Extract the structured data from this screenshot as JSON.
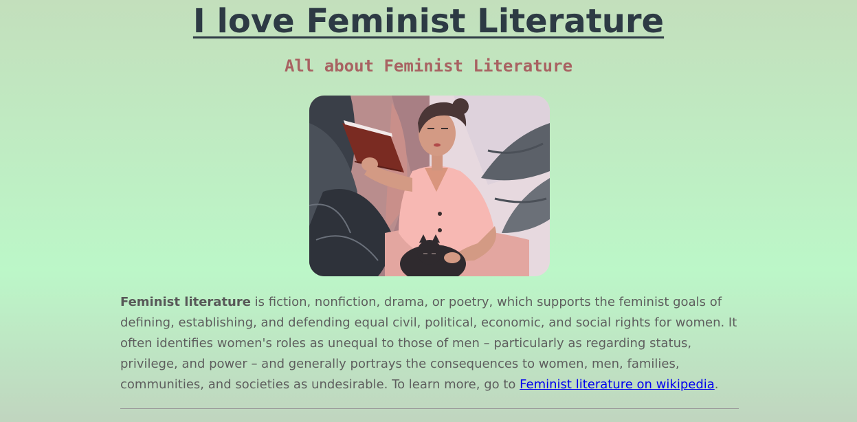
{
  "header": {
    "title": "I love Feminist Literature",
    "subtitle": "All about Feminist Literature"
  },
  "hero": {
    "icon": "woman-reading-illustration"
  },
  "intro": {
    "term": "Feminist literature",
    "text_before_link": " is fiction, nonfiction, drama, or poetry, which supports the feminist goals of defining, establishing, and defending equal civil, political, economic, and social rights for women. It often identifies women's roles as unequal to those of men – particularly as regarding status, privilege, and power – and generally portrays the consequences to women, men, families, communities, and societies as undesirable. To learn more, go to ",
    "link_label": "Feminist literature on wikipedia",
    "text_after_link": "."
  },
  "colors": {
    "background_top": "#c3dfbc",
    "background_mid": "#bcf7c8",
    "title": "#2d3a44",
    "subtitle": "#a86262",
    "body_text": "#5e5e5e",
    "link": "#0000ee"
  }
}
